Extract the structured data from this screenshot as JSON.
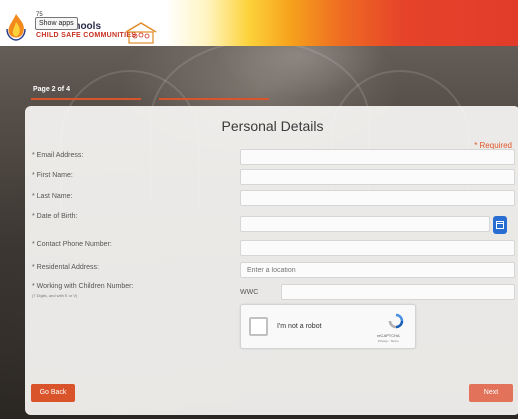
{
  "header": {
    "logo_tiny": "75",
    "logo_title": "holic Schools",
    "logo_subtitle": "CHILD SAFE COMMUNITIES",
    "show_apps_tooltip": "Show apps"
  },
  "pagination": {
    "label": "Page 2 of 4"
  },
  "form": {
    "title": "Personal Details",
    "required_note": "* Required",
    "fields": [
      {
        "label": "* Email Address:",
        "value": "",
        "placeholder": ""
      },
      {
        "label": "* First Name:",
        "value": "",
        "placeholder": ""
      },
      {
        "label": "* Last Name:",
        "value": "",
        "placeholder": ""
      },
      {
        "label": "* Date of Birth:",
        "value": "",
        "placeholder": ""
      },
      {
        "label": "* Contact Phone Number:",
        "value": "",
        "placeholder": ""
      },
      {
        "label": "* Residental Address:",
        "value": "",
        "placeholder": "Enter a location"
      },
      {
        "label": "* Working with Children Number:",
        "sublabel": "(7 Digits, and with E or V)",
        "prefix": "WWC",
        "value": "",
        "placeholder": ""
      }
    ],
    "captcha": {
      "label": "I'm not a robot",
      "brand": "reCAPTCHA",
      "terms": "Privacy - Terms"
    }
  },
  "buttons": {
    "back": "Go Back",
    "next": "Next"
  },
  "colors": {
    "accent": "#d9542b",
    "calendar": "#2a6dd2"
  }
}
